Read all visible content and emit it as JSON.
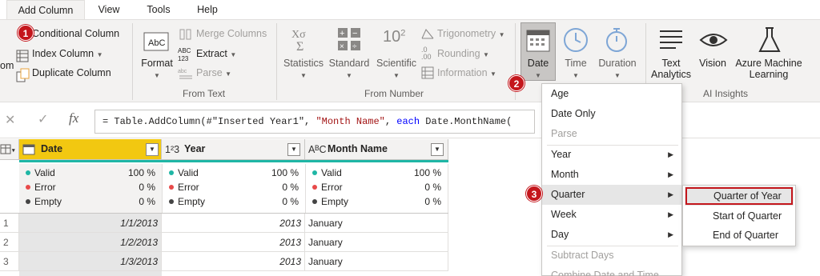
{
  "tabs": [
    {
      "label": "Add Column",
      "active": true
    },
    {
      "label": "View"
    },
    {
      "label": "Tools"
    },
    {
      "label": "Help"
    }
  ],
  "ribbon": {
    "general": {
      "partial_label": "om",
      "conditional": "Conditional Column",
      "index": "Index Column",
      "duplicate": "Duplicate Column"
    },
    "from_text": {
      "format": "Format",
      "merge": "Merge Columns",
      "extract": "Extract",
      "parse": "Parse",
      "group_label": "From Text"
    },
    "from_number": {
      "statistics": "Statistics",
      "standard": "Standard",
      "scientific": "Scientific",
      "trig": "Trigonometry",
      "rounding": "Rounding",
      "information": "Information",
      "group_label": "From Number",
      "scientific_icon": "10",
      "scientific_sup": "2"
    },
    "datetime": {
      "date": "Date",
      "time": "Time",
      "duration": "Duration"
    },
    "ai": {
      "text_analytics_1": "Text",
      "text_analytics_2": "Analytics",
      "vision": "Vision",
      "azure_ml_1": "Azure Machine",
      "azure_ml_2": "Learning",
      "group_label": "AI Insights"
    }
  },
  "formula": {
    "cancel_icon": "✕",
    "commit_icon": "✓",
    "fx": "fx",
    "text_prefix": "= Table.AddColumn(#\"Inserted Year1\", ",
    "text_str": "\"Month Name\"",
    "text_mid": ", ",
    "text_kw": "each",
    "text_suffix": " Date.MonthName("
  },
  "grid": {
    "columns": [
      {
        "type": "",
        "name": "Date",
        "selected": true
      },
      {
        "type": "1²3",
        "name": "Year"
      },
      {
        "type": "AᴮC",
        "name": "Month Name"
      }
    ],
    "quality_labels": [
      "Valid",
      "Error",
      "Empty"
    ],
    "quality_values": [
      [
        "100 %",
        "0 %",
        "0 %"
      ],
      [
        "100 %",
        "0 %",
        "0 %"
      ],
      [
        "100 %",
        "0 %",
        "0 %"
      ]
    ],
    "rows": [
      {
        "n": "1",
        "date": "1/1/2013",
        "year": "2013",
        "month": "January"
      },
      {
        "n": "2",
        "date": "1/2/2013",
        "year": "2013",
        "month": "January"
      },
      {
        "n": "3",
        "date": "1/3/2013",
        "year": "2013",
        "month": "January"
      }
    ]
  },
  "date_menu": {
    "items": [
      {
        "label": "Age"
      },
      {
        "label": "Date Only"
      },
      {
        "label": "Parse",
        "disabled": true
      },
      {
        "label": "Year",
        "sub": true
      },
      {
        "label": "Month",
        "sub": true
      },
      {
        "label": "Quarter",
        "sub": true,
        "highlight": true
      },
      {
        "label": "Week",
        "sub": true
      },
      {
        "label": "Day",
        "sub": true
      },
      {
        "label": "Subtract Days",
        "disabled": true
      },
      {
        "label": "Combine Date and Time",
        "disabled": true
      }
    ]
  },
  "quarter_menu": {
    "items": [
      "Quarter of Year",
      "Start of Quarter",
      "End of Quarter"
    ]
  },
  "badges": [
    "1",
    "2",
    "3"
  ],
  "colors": {
    "accent_red": "#c4161c",
    "selected_header": "#f2c811",
    "quality_bar": "#1fb6a5",
    "valid": "#1fb6a5",
    "error": "#e84a4a",
    "empty": "#444"
  }
}
